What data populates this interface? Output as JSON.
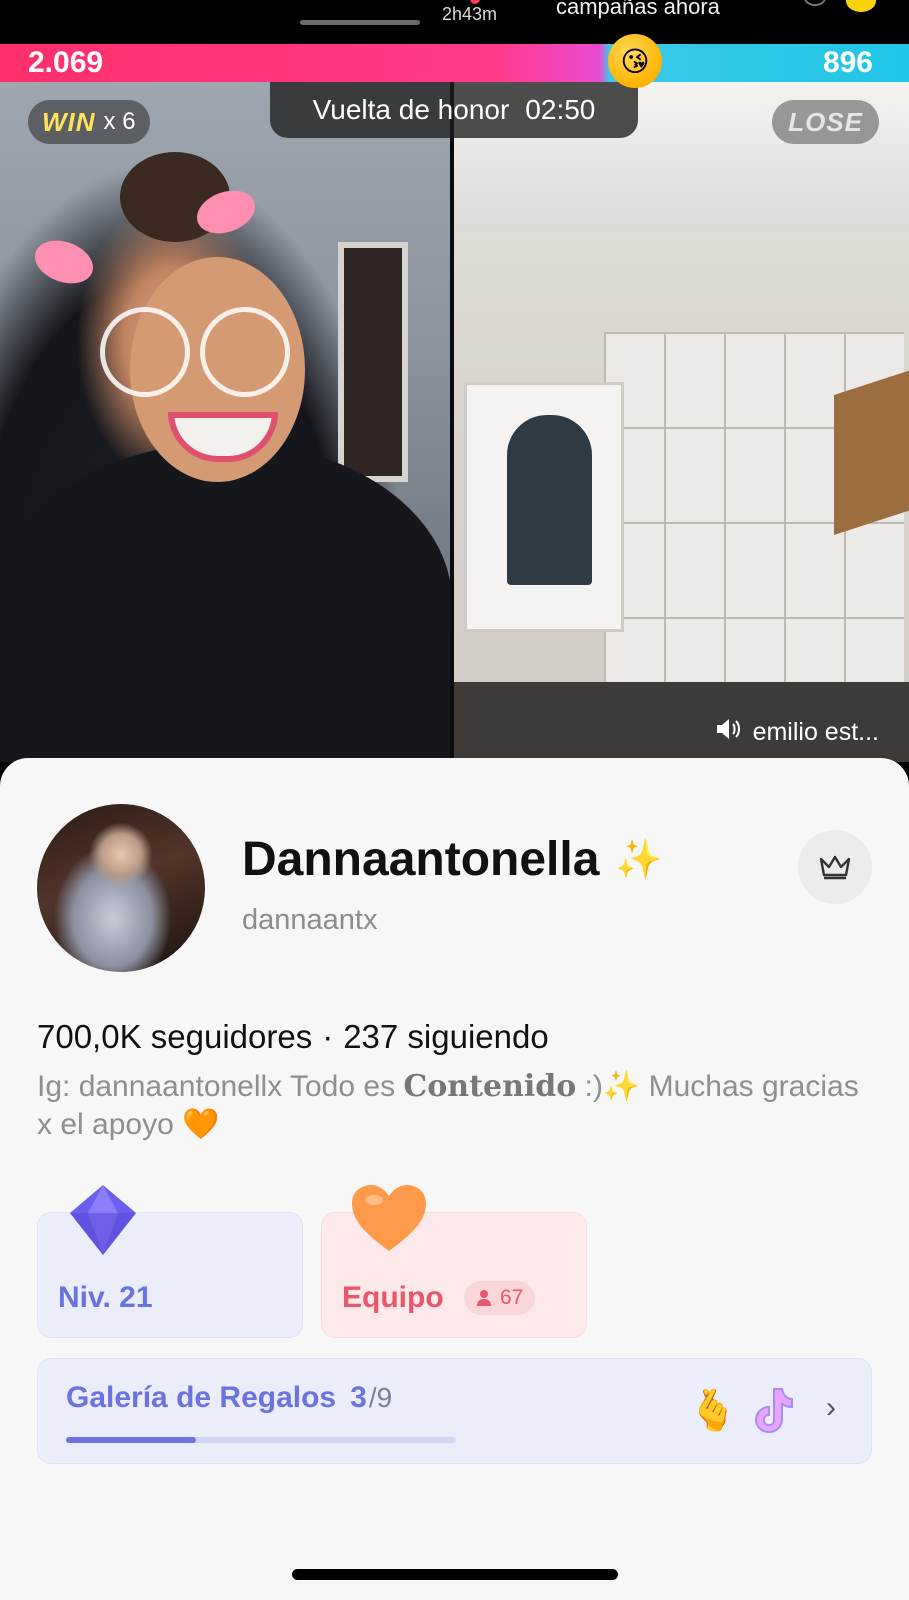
{
  "status": {
    "duration": "2h43m",
    "campaign_text": "campañas ahora"
  },
  "battle": {
    "left_score": "2.069",
    "right_score": "896",
    "win_label": "WIN",
    "win_multiplier": "x 6",
    "timer_label": "Vuelta de honor",
    "timer_value": "02:50",
    "lose_label": "LOSE",
    "opponent_name": "emilio est...",
    "score_share_left": 0.698
  },
  "profile": {
    "display_name": "Dannaantonella",
    "name_emoji": "✨",
    "handle": "dannaantx",
    "followers": "700,0K seguidores",
    "separator": "·",
    "following": "237 siguiendo",
    "bio_prefix": "Ig: dannaantonellx  Todo es",
    "bio_styled": "𝐂𝐨𝐧𝐭𝐞𝐧𝐢𝐝𝐨",
    "bio_suffix": ":)✨ Muchas gracias x el apoyo 🧡"
  },
  "cards": {
    "level_label": "Niv. 21",
    "team_label": "Equipo",
    "team_members": "67"
  },
  "gallery": {
    "title": "Galería de Regalos",
    "collected": "3",
    "total": "/9",
    "progress": 0.333
  },
  "icons": {
    "crown": "crown-icon",
    "speaker": "speaker-icon",
    "diamond": "diamond-icon",
    "heart": "heart-icon",
    "person": "person-icon",
    "chevron": "chevron-right-icon"
  },
  "colors": {
    "accent_blue": "#6b73e0",
    "accent_red": "#e8576b",
    "score_left": "#ff2f6b",
    "score_right": "#20c6e6"
  }
}
